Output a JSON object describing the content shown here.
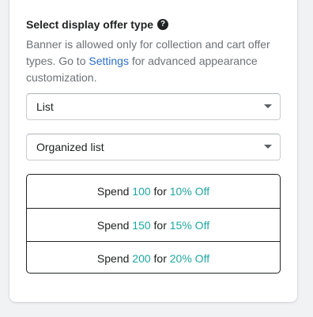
{
  "section": {
    "heading": "Select display offer type",
    "help_icon": "question-circle-icon",
    "desc_before": "Banner is allowed only for collection and cart offer types. Go to ",
    "desc_link": "Settings",
    "desc_after": " for advanced appearance customization."
  },
  "selects": {
    "display_type": "List",
    "list_style": "Organized list"
  },
  "preview": {
    "rows": [
      {
        "spend_label": "Spend",
        "amount": "100",
        "for_label": "for",
        "discount": "10% Off"
      },
      {
        "spend_label": "Spend",
        "amount": "150",
        "for_label": "for",
        "discount": "15% Off"
      },
      {
        "spend_label": "Spend",
        "amount": "200",
        "for_label": "for",
        "discount": "20% Off"
      }
    ]
  },
  "colors": {
    "highlight": "#1fa7a0",
    "link": "#2c6ecb",
    "text": "#202223",
    "subdued": "#6d7175"
  }
}
